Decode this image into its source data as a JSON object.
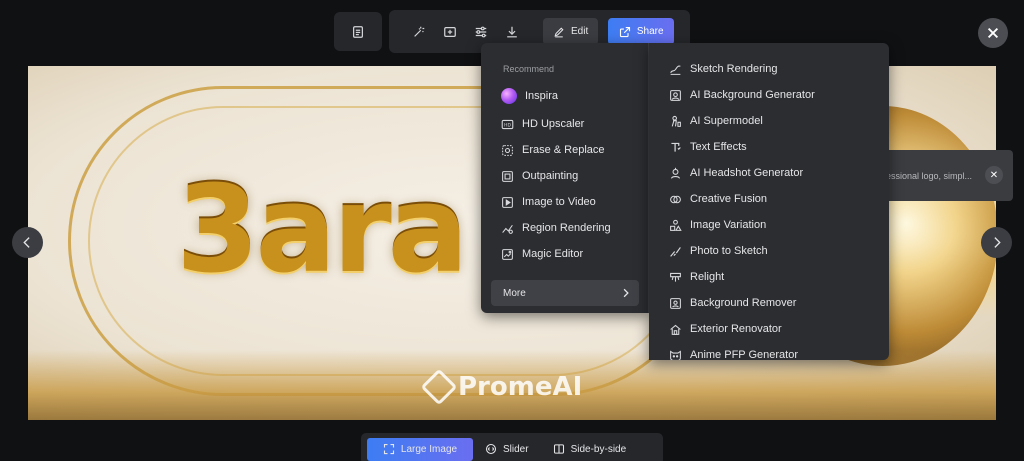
{
  "toolbar": {
    "edit_label": "Edit",
    "share_label": "Share",
    "icons": [
      "document-icon",
      "magic-wand-icon",
      "add-image-icon",
      "adjust-icon",
      "download-icon"
    ]
  },
  "image": {
    "main_text": "3ara",
    "watermark": "PromeAI"
  },
  "prompt_popup": {
    "text": "essional logo, simpl..."
  },
  "menu": {
    "heading": "Recommend",
    "recommend_items": [
      {
        "label": "Inspira",
        "icon": "inspira-icon"
      },
      {
        "label": "HD Upscaler",
        "icon": "hd-icon"
      },
      {
        "label": "Erase & Replace",
        "icon": "erase-icon"
      },
      {
        "label": "Outpainting",
        "icon": "outpainting-icon"
      },
      {
        "label": "Image to Video",
        "icon": "video-icon"
      },
      {
        "label": "Region Rendering",
        "icon": "region-icon"
      },
      {
        "label": "Magic Editor",
        "icon": "magic-editor-icon"
      }
    ],
    "more_label": "More",
    "more_items": [
      {
        "label": "Sketch Rendering",
        "icon": "sketch-icon"
      },
      {
        "label": "AI Background Generator",
        "icon": "background-icon"
      },
      {
        "label": "AI Supermodel",
        "icon": "supermodel-icon"
      },
      {
        "label": "Text Effects",
        "icon": "text-effects-icon"
      },
      {
        "label": "AI Headshot Generator",
        "icon": "headshot-icon"
      },
      {
        "label": "Creative Fusion",
        "icon": "fusion-icon"
      },
      {
        "label": "Image Variation",
        "icon": "variation-icon"
      },
      {
        "label": "Photo to Sketch",
        "icon": "photo-sketch-icon"
      },
      {
        "label": "Relight",
        "icon": "relight-icon"
      },
      {
        "label": "Background Remover",
        "icon": "bg-remover-icon"
      },
      {
        "label": "Exterior Renovator",
        "icon": "exterior-icon"
      },
      {
        "label": "Anime PFP Generator",
        "icon": "anime-icon"
      }
    ]
  },
  "view_modes": {
    "large_image": "Large Image",
    "slider": "Slider",
    "side_by_side": "Side-by-side",
    "active": "Large Image"
  },
  "colors": {
    "accent": "#3d7df3",
    "panel": "#2b2d31",
    "background": "#101113"
  }
}
